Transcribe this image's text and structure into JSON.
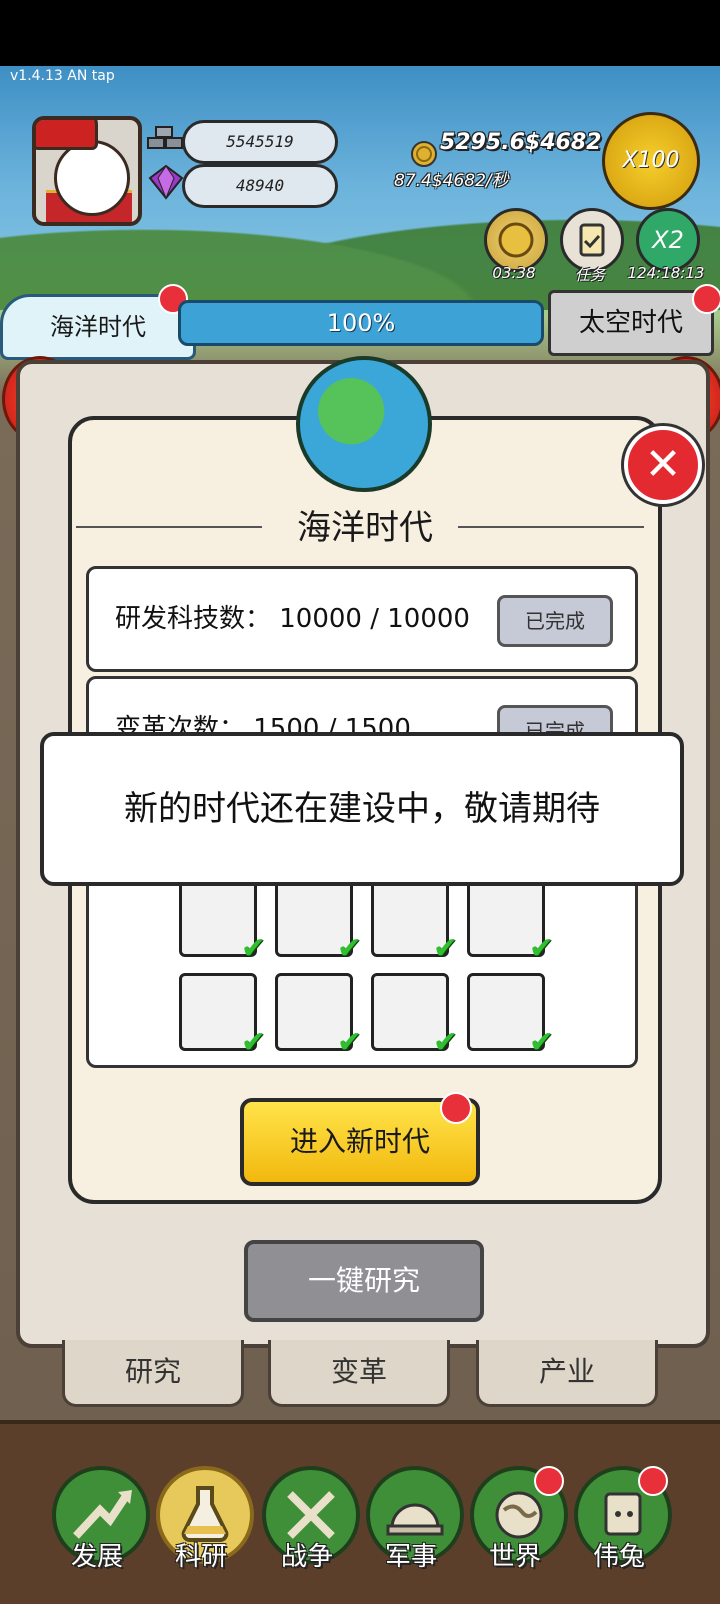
{
  "version": "v1.4.13 AN tap",
  "resources": {
    "metal": "5545519",
    "gems": "48940",
    "coins": "5295.6$4682",
    "rate": "87.4$4682/秒",
    "x100_label": "X100"
  },
  "round_buttons": [
    {
      "icon": "coin-stack-icon",
      "label": "03:38"
    },
    {
      "icon": "task-clipboard-icon",
      "label": "任务"
    },
    {
      "icon": "x2-boost-icon",
      "text": "X2",
      "label": "124:18:13"
    }
  ],
  "era": {
    "current": "海洋时代",
    "next": "太空时代",
    "progress": "100%"
  },
  "modal": {
    "title": "海洋时代",
    "rows": [
      {
        "label": "研发科技数：  10000 / 10000",
        "button": "已完成"
      },
      {
        "label": "变革次数：  1500 / 1500",
        "button": "已完成"
      }
    ],
    "buildings": [
      "opera-house-icon",
      "building-icon",
      "lunar-lander-icon",
      "tower-icon",
      "robot-icon",
      "space-station-icon",
      "ufo-icon",
      "satellite-icon"
    ],
    "enter_label": "进入新时代",
    "close_icon": "close-icon"
  },
  "toast": "新的时代还在建设中，敬请期待",
  "research_button": "一键研究",
  "tabs": [
    "研究",
    "变革",
    "产业"
  ],
  "bottom_nav": [
    {
      "icon": "growth-arrow-icon",
      "label": "发展",
      "active": false,
      "badge": false
    },
    {
      "icon": "flask-icon",
      "label": "科研",
      "active": true,
      "badge": false
    },
    {
      "icon": "crossed-swords-icon",
      "label": "战争",
      "active": false,
      "badge": false
    },
    {
      "icon": "helmet-icon",
      "label": "军事",
      "active": false,
      "badge": false
    },
    {
      "icon": "globe-icon",
      "label": "世界",
      "active": false,
      "badge": true
    },
    {
      "icon": "rabbit-portrait-icon",
      "label": "伟兔",
      "active": false,
      "badge": true
    }
  ],
  "colors": {
    "accent_yellow": "#f2c21a",
    "alert_red": "#e22a30",
    "nav_green": "#3f8f38"
  }
}
